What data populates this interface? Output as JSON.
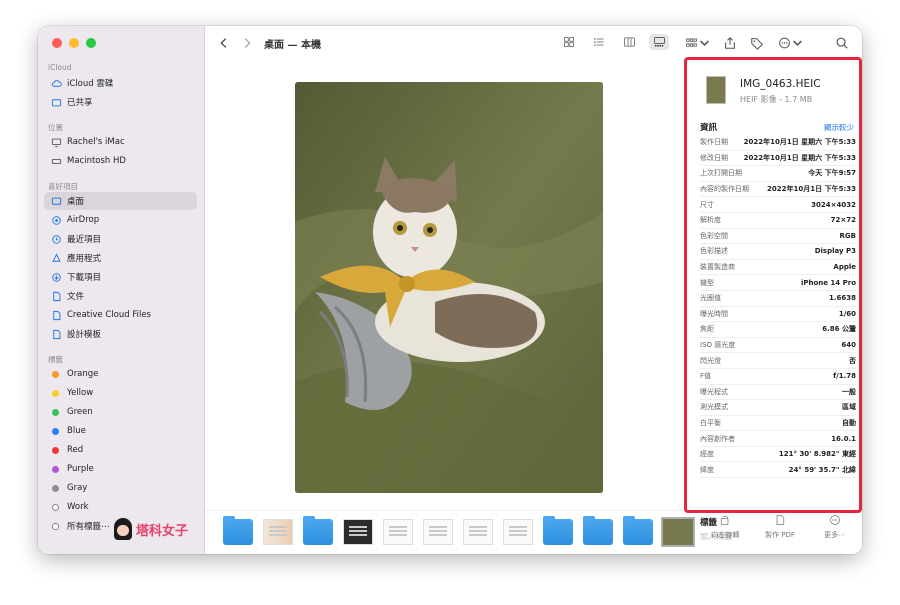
{
  "window": {
    "title": "桌面 — 本機"
  },
  "sidebar": {
    "sections": {
      "icloud": "iCloud",
      "locations": "位置",
      "favorites": "喜好項目",
      "tags": "標籤"
    },
    "icloud_items": [
      {
        "label": "iCloud 雲碟",
        "icon": "cloud-icon"
      },
      {
        "label": "已共享",
        "icon": "shared-folder-icon"
      }
    ],
    "location_items": [
      {
        "label": "Rachel's iMac",
        "icon": "computer-icon"
      },
      {
        "label": "Macintosh HD",
        "icon": "disk-icon"
      }
    ],
    "favorite_items": [
      {
        "label": "桌面",
        "icon": "desktop-icon",
        "selected": true
      },
      {
        "label": "AirDrop",
        "icon": "airdrop-icon"
      },
      {
        "label": "最近項目",
        "icon": "clock-icon"
      },
      {
        "label": "應用程式",
        "icon": "applications-icon"
      },
      {
        "label": "下載項目",
        "icon": "download-icon"
      },
      {
        "label": "文件",
        "icon": "document-icon"
      },
      {
        "label": "Creative Cloud Files",
        "icon": "file-icon"
      },
      {
        "label": "設計模板",
        "icon": "file-icon"
      }
    ],
    "tag_items": [
      {
        "label": "Orange",
        "color": "#f59a23"
      },
      {
        "label": "Yellow",
        "color": "#f7cf2a"
      },
      {
        "label": "Green",
        "color": "#35c25a"
      },
      {
        "label": "Blue",
        "color": "#2e7cf6"
      },
      {
        "label": "Red",
        "color": "#f0383c"
      },
      {
        "label": "Purple",
        "color": "#b155d9"
      },
      {
        "label": "Gray",
        "color": "#8e8e93"
      },
      {
        "label": "Work",
        "color": "#ffffff"
      },
      {
        "label": "所有標籤⋯",
        "color": "all"
      }
    ],
    "logo_text": "塔科女子"
  },
  "inspector": {
    "file_name": "IMG_0463.HEIC",
    "file_sub": "HEIF 影像 - 1.7 MB",
    "info_title": "資訊",
    "show_less": "顯示較少",
    "rows": [
      {
        "k": "製作日期",
        "v": "2022年10月1日 星期六 下午5:33"
      },
      {
        "k": "修改日期",
        "v": "2022年10月1日 星期六 下午5:33"
      },
      {
        "k": "上次打開日期",
        "v": "今天 下午9:57"
      },
      {
        "k": "內容的製作日期",
        "v": "2022年10月1日 下午5:33"
      },
      {
        "k": "尺寸",
        "v": "3024×4032"
      },
      {
        "k": "解析度",
        "v": "72×72"
      },
      {
        "k": "色彩空間",
        "v": "RGB"
      },
      {
        "k": "色彩描述",
        "v": "Display P3"
      },
      {
        "k": "裝置製造商",
        "v": "Apple"
      },
      {
        "k": "機型",
        "v": "iPhone 14 Pro"
      },
      {
        "k": "光圈值",
        "v": "1.6638"
      },
      {
        "k": "曝光時間",
        "v": "1/60"
      },
      {
        "k": "焦距",
        "v": "6.86 公釐"
      },
      {
        "k": "ISO 感光度",
        "v": "640"
      },
      {
        "k": "閃光燈",
        "v": "否"
      },
      {
        "k": "F值",
        "v": "f/1.78"
      },
      {
        "k": "曝光程式",
        "v": "一般"
      },
      {
        "k": "測光模式",
        "v": "區域"
      },
      {
        "k": "白平衡",
        "v": "自動"
      },
      {
        "k": "內容創作者",
        "v": "16.0.1"
      },
      {
        "k": "經度",
        "v": "121° 30' 8.982\" 東經"
      },
      {
        "k": "緯度",
        "v": "24° 59' 35.7\" 北緯"
      }
    ],
    "tags_title": "標籤",
    "add_tag": "加入標籤⋯"
  },
  "actions": [
    {
      "label": "向左旋轉",
      "icon": "rotate-left-icon"
    },
    {
      "label": "製作 PDF",
      "icon": "pdf-icon"
    },
    {
      "label": "更多⋯",
      "icon": "more-icon"
    }
  ],
  "filmstrip": [
    "folder",
    "doc-color",
    "folder",
    "doc-dark",
    "doc",
    "doc",
    "doc",
    "doc",
    "folder",
    "folder",
    "folder",
    "photo"
  ],
  "colors": {
    "accent": "#1a73e8",
    "highlight_box": "#e5263d"
  }
}
